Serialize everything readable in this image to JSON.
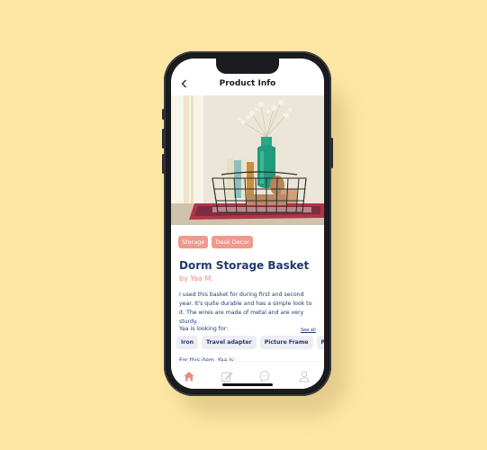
{
  "header": {
    "title": "Product Info",
    "back_icon": "chevron-left-icon"
  },
  "product": {
    "tags": [
      "Storage",
      "Desk Decor"
    ],
    "name": "Dorm Storage Basket",
    "seller": "by Yaa M.",
    "description": "I used this basket for during first and second year. It's quite durable and has a simple look to it. The wires are made of metal and are very sturdy."
  },
  "looking_for": {
    "label": "Yaa is looking for:",
    "see_all": "See all",
    "items": [
      "Iron",
      "Travel adapter",
      "Picture Frame",
      "Plant Pot"
    ]
  },
  "for_this_item": {
    "label": "For this item, Yaa is:"
  },
  "nav": {
    "items": [
      {
        "icon": "home-icon",
        "active": true
      },
      {
        "icon": "edit-icon",
        "active": false
      },
      {
        "icon": "chat-icon",
        "active": false
      },
      {
        "icon": "profile-icon",
        "active": false
      }
    ]
  },
  "colors": {
    "background": "#fde6a3",
    "accent": "#ee9a8d",
    "primary_text": "#1f3a6e",
    "chip_bg": "#eceef3"
  }
}
